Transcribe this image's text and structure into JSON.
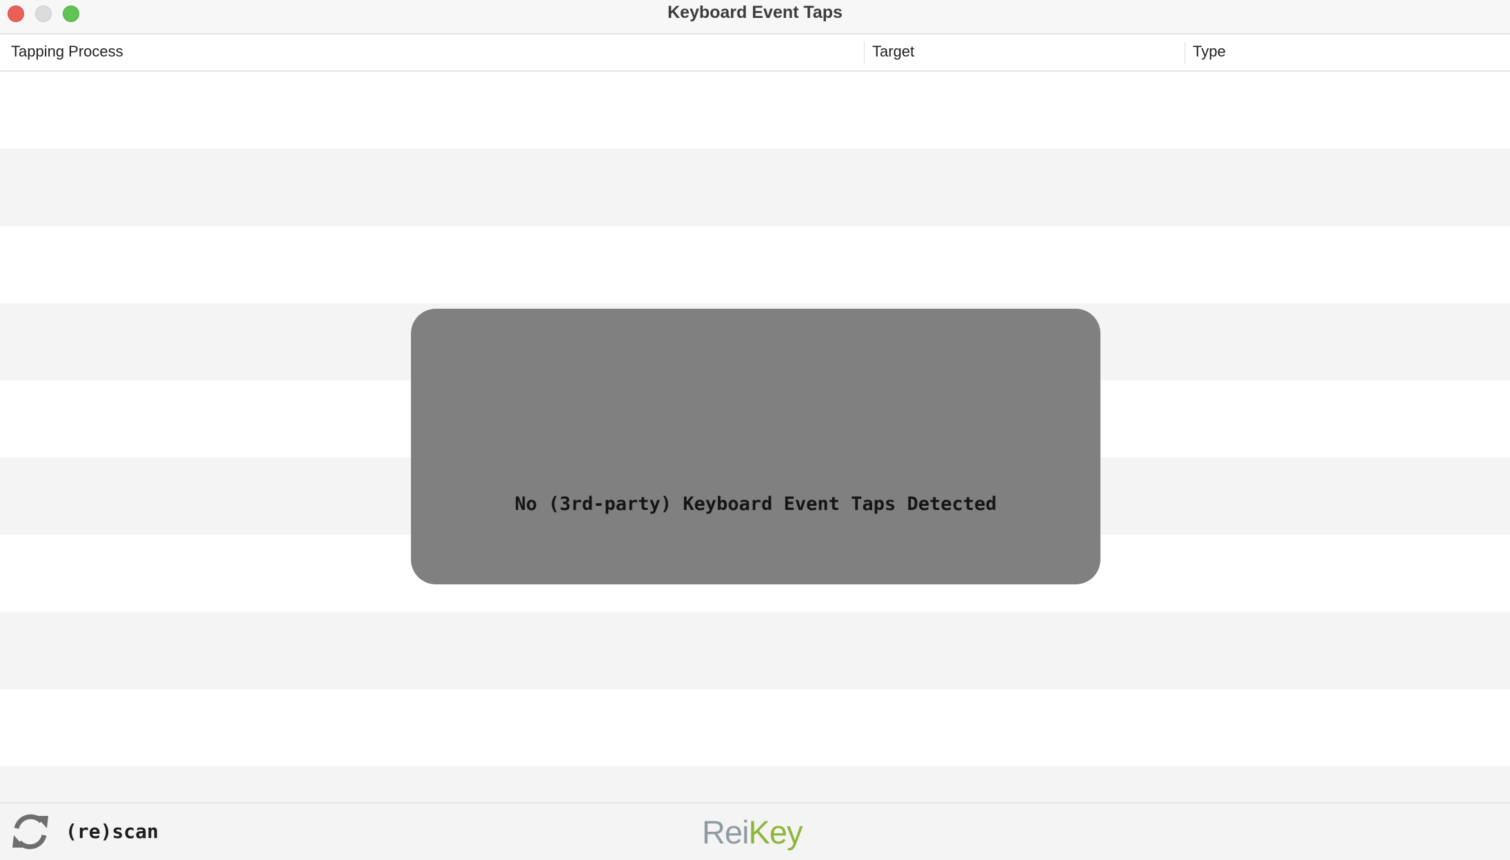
{
  "window": {
    "title": "Keyboard Event Taps"
  },
  "table": {
    "columns": [
      "Tapping Process",
      "Target",
      "Type"
    ]
  },
  "overlay": {
    "message": "No (3rd-party) Keyboard Event Taps Detected"
  },
  "footer": {
    "rescan_label": "(re)scan",
    "logo_part1": "Rei",
    "logo_part2": "Key"
  },
  "colors": {
    "logo_gray": "#8f9ca3",
    "logo_green": "#8fb63a",
    "overlay_bg": "#808080"
  }
}
